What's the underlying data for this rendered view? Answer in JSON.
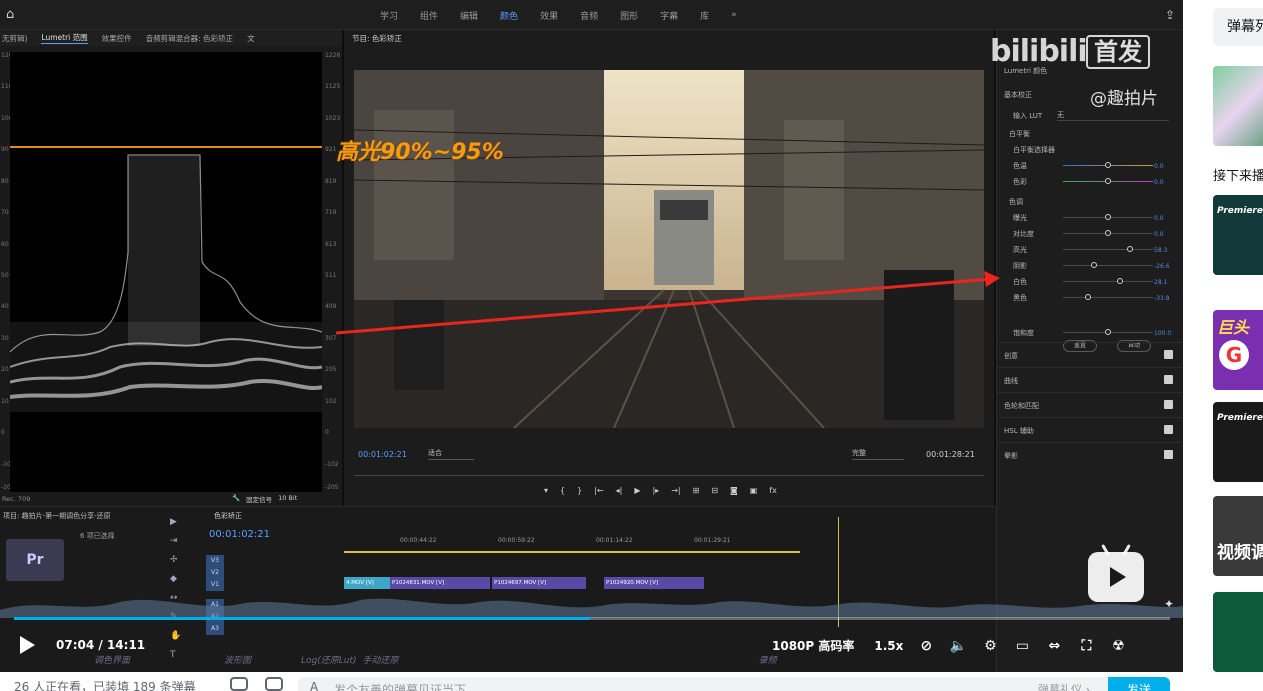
{
  "premiere": {
    "menu": [
      "学习",
      "组件",
      "编辑",
      "颜色",
      "效果",
      "音频",
      "图形",
      "字幕",
      "库"
    ],
    "active_menu": "颜色",
    "scope_tabs": [
      "无剪辑)",
      "Lumetri 范围",
      "效果控件",
      "音频剪辑混合器: 色彩矫正",
      "文"
    ],
    "scope_left_ticks": [
      "120",
      "110",
      "100",
      "90",
      "80",
      "70",
      "60",
      "50",
      "40",
      "30",
      "20",
      "10",
      "0",
      "-10",
      "-20"
    ],
    "scope_right_ticks": [
      "1226",
      "1125",
      "1023",
      "921",
      "819",
      "719",
      "613",
      "511",
      "409",
      "307",
      "205",
      "102",
      "0",
      "-102",
      "-205"
    ],
    "scope_footer": "Rec. 709",
    "clamp_label": "固定信号",
    "bit_label": "10 Bit",
    "monitor_title": "节目: 色彩矫正",
    "monitor_time": "00:01:02:21",
    "monitor_fit": "适合",
    "monitor_quality": "完整",
    "monitor_duration": "00:01:28:21",
    "annotation": "高光90%~95%"
  },
  "lumetri": {
    "title": "Lumetri 颜色",
    "basic": "基本校正",
    "input_lut": "输入 LUT",
    "lut_value": "无",
    "white_balance": "白平衡",
    "wb_picker": "白平衡选择器",
    "temp": {
      "label": "色温",
      "value": "0.0"
    },
    "tint": {
      "label": "色彩",
      "value": "0.0"
    },
    "tone": "色调",
    "sliders": [
      {
        "label": "曝光",
        "value": "0.0"
      },
      {
        "label": "对比度",
        "value": "0.0"
      },
      {
        "label": "高光",
        "value": "58.3"
      },
      {
        "label": "阴影",
        "value": "-26.6"
      },
      {
        "label": "白色",
        "value": "28.1"
      },
      {
        "label": "黑色",
        "value": "-33.8"
      }
    ],
    "reset": "重置",
    "auto": "自动",
    "saturation": {
      "label": "饱和度",
      "value": "100.0"
    },
    "sections": [
      "创意",
      "曲线",
      "色轮和匹配",
      "HSL 辅助",
      "晕影"
    ]
  },
  "timeline": {
    "project_tab": "项目: 趣拍片-第一期调色分享-还原",
    "project_items": "6 项已选择",
    "sequence_tab": "色彩矫正",
    "timecode": "00:01:02:21",
    "ruler_marks": [
      "00:00:44:22",
      "00:00:59:22",
      "00:01:14:22",
      "00:01:29:21"
    ],
    "clips": [
      "4.MOV [V]",
      "P1024831.MOV [V]",
      "P1024697.MOV [V]",
      "P1024920.MOV [V]"
    ],
    "tracks": [
      "V3",
      "V2",
      "V1",
      "A1",
      "A2",
      "A3"
    ]
  },
  "watermark": {
    "logo": "bilibili",
    "badge": "首发",
    "handle": "@趣拍片"
  },
  "player": {
    "current_time": "07:04",
    "total_time": "14:11",
    "quality": "1080P 高码率",
    "speed": "1.5x",
    "progress": 0.498,
    "chapters": [
      "调色界面",
      "波形图",
      "Log(还原Lut)",
      "手动还原",
      "",
      "",
      "",
      "",
      "录频"
    ]
  },
  "bottom": {
    "watching": "26 人正在看，已装填 189 条弹幕",
    "placeholder": "发个友善的弹幕见证当下",
    "etiquette": "弹幕礼仪 ›",
    "send": "发送"
  },
  "sidebar": {
    "danmaku_list": "弹幕列",
    "up_next": "接下来播",
    "thumbs": [
      "Premiere 风格化",
      "巨头",
      "Premiere 二级调",
      "视频调",
      ""
    ]
  }
}
